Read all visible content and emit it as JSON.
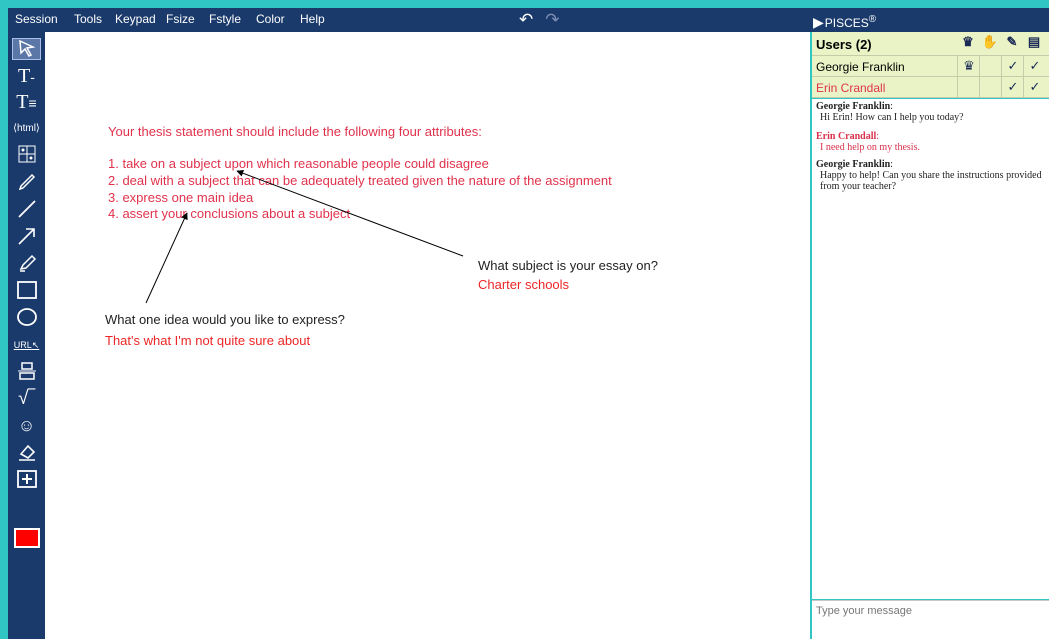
{
  "menu": [
    "Session",
    "Tools",
    "Keypad",
    "Fsize",
    "Fstyle",
    "Color",
    "Help"
  ],
  "brand": "PISCES",
  "brand_mark": "®",
  "toolbar": [
    "select-tool",
    "text-tool",
    "text-block-tool",
    "html-tool",
    "keypad-tool",
    "pencil-tool",
    "line-tool",
    "arrow-tool",
    "highlighter-tool",
    "rectangle-tool",
    "ellipse-tool",
    "url-tool",
    "align-tool",
    "math-tool",
    "emoji-tool",
    "eraser-tool",
    "add-page-tool"
  ],
  "toolbar_glyphs": {
    "text": "T",
    "html": "⟨html⟩",
    "url": "URL"
  },
  "current_color": "#ff0000",
  "canvas": {
    "heading": "Your thesis statement should include the following four attributes:",
    "items": [
      "1. take on a subject upon which reasonable people could disagree",
      "2. deal with a subject that can be adequately treated given the nature of the assignment",
      "3. express one main idea",
      "4. assert your conclusions about a subject"
    ],
    "question1": "What subject is your essay on?",
    "answer1": "Charter schools",
    "question2": "What one idea would you like to express?",
    "answer2": "That's what I'm not quite sure about"
  },
  "users": {
    "header": "Users (2)",
    "list": [
      {
        "name": "Georgie Franklin",
        "color": "#222222",
        "crown": true,
        "hand": false,
        "edit": true,
        "chat": true
      },
      {
        "name": "Erin Crandall",
        "color": "#e0324c",
        "crown": false,
        "hand": false,
        "edit": true,
        "chat": true
      }
    ]
  },
  "chat": [
    {
      "from": "Georgie Franklin",
      "role": "agent",
      "text": "Hi Erin! How can I help you today?"
    },
    {
      "from": "Erin Crandall",
      "role": "student",
      "text": "I need help on my thesis."
    },
    {
      "from": "Georgie Franklin",
      "role": "agent",
      "text": "Happy to help! Can you share the instructions provided from your teacher?"
    }
  ],
  "chat_placeholder": "Type your message",
  "colors": {
    "app_bg": "#30c6c3",
    "toolbar_bg": "#1a3a6b",
    "text_red": "#e0324c",
    "answer_red": "#ec2626",
    "users_bg": "#e9f3c6"
  }
}
